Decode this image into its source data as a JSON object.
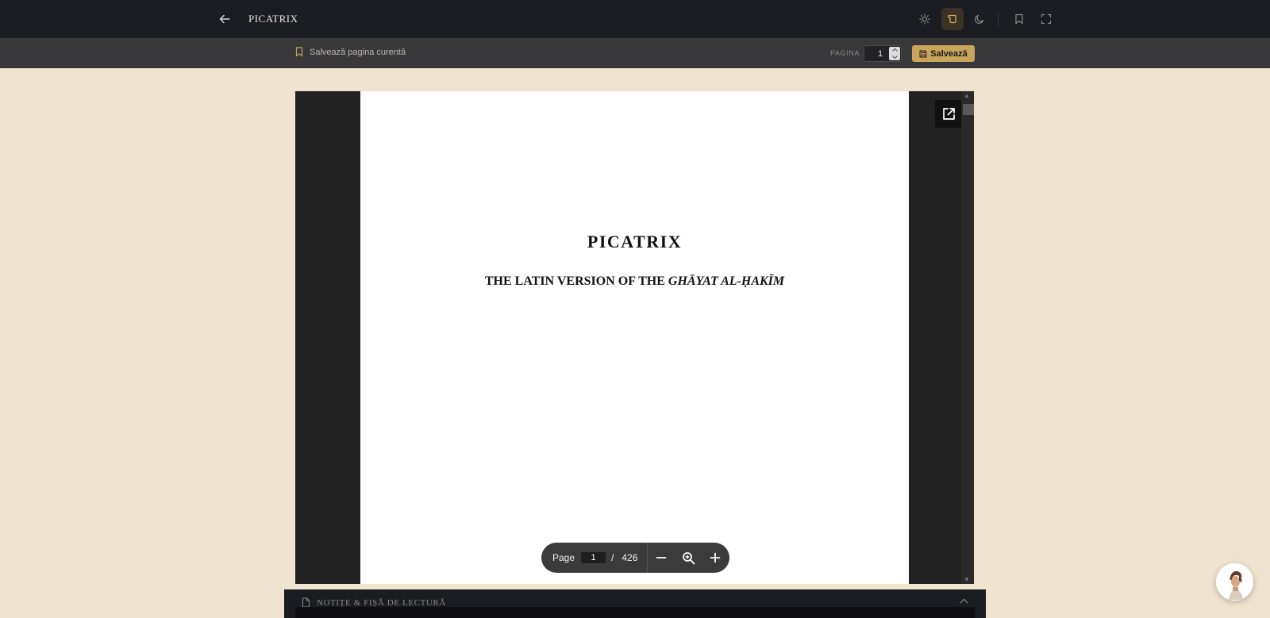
{
  "header": {
    "title": "PICATRIX",
    "icons": [
      "back-arrow-icon",
      "sun-icon",
      "scroll-icon",
      "moon-icon",
      "bookmark-icon",
      "fullscreen-icon"
    ],
    "active_mode": "scroll-icon"
  },
  "subbar": {
    "save_current_label": "Salvează pagina curentă",
    "pagina_label": "PAGINA",
    "page_value": "1",
    "save_button_label": "Salvează"
  },
  "document": {
    "title": "PICATRIX",
    "subtitle_plain": "THE LATIN VERSION OF THE ",
    "subtitle_italic": "GHĀYAT AL-ḤAKĪM"
  },
  "pdf_toolbar": {
    "page_label": "Page",
    "current_page": "1",
    "separator": "/",
    "total_pages": "426"
  },
  "notes": {
    "title": "NOTIȚE & FIȘĂ DE LECTURĂ"
  },
  "colors": {
    "background": "#efe4cf",
    "topbar": "#1b1b22",
    "subbar": "#38383a",
    "accent": "#c9a45d"
  }
}
